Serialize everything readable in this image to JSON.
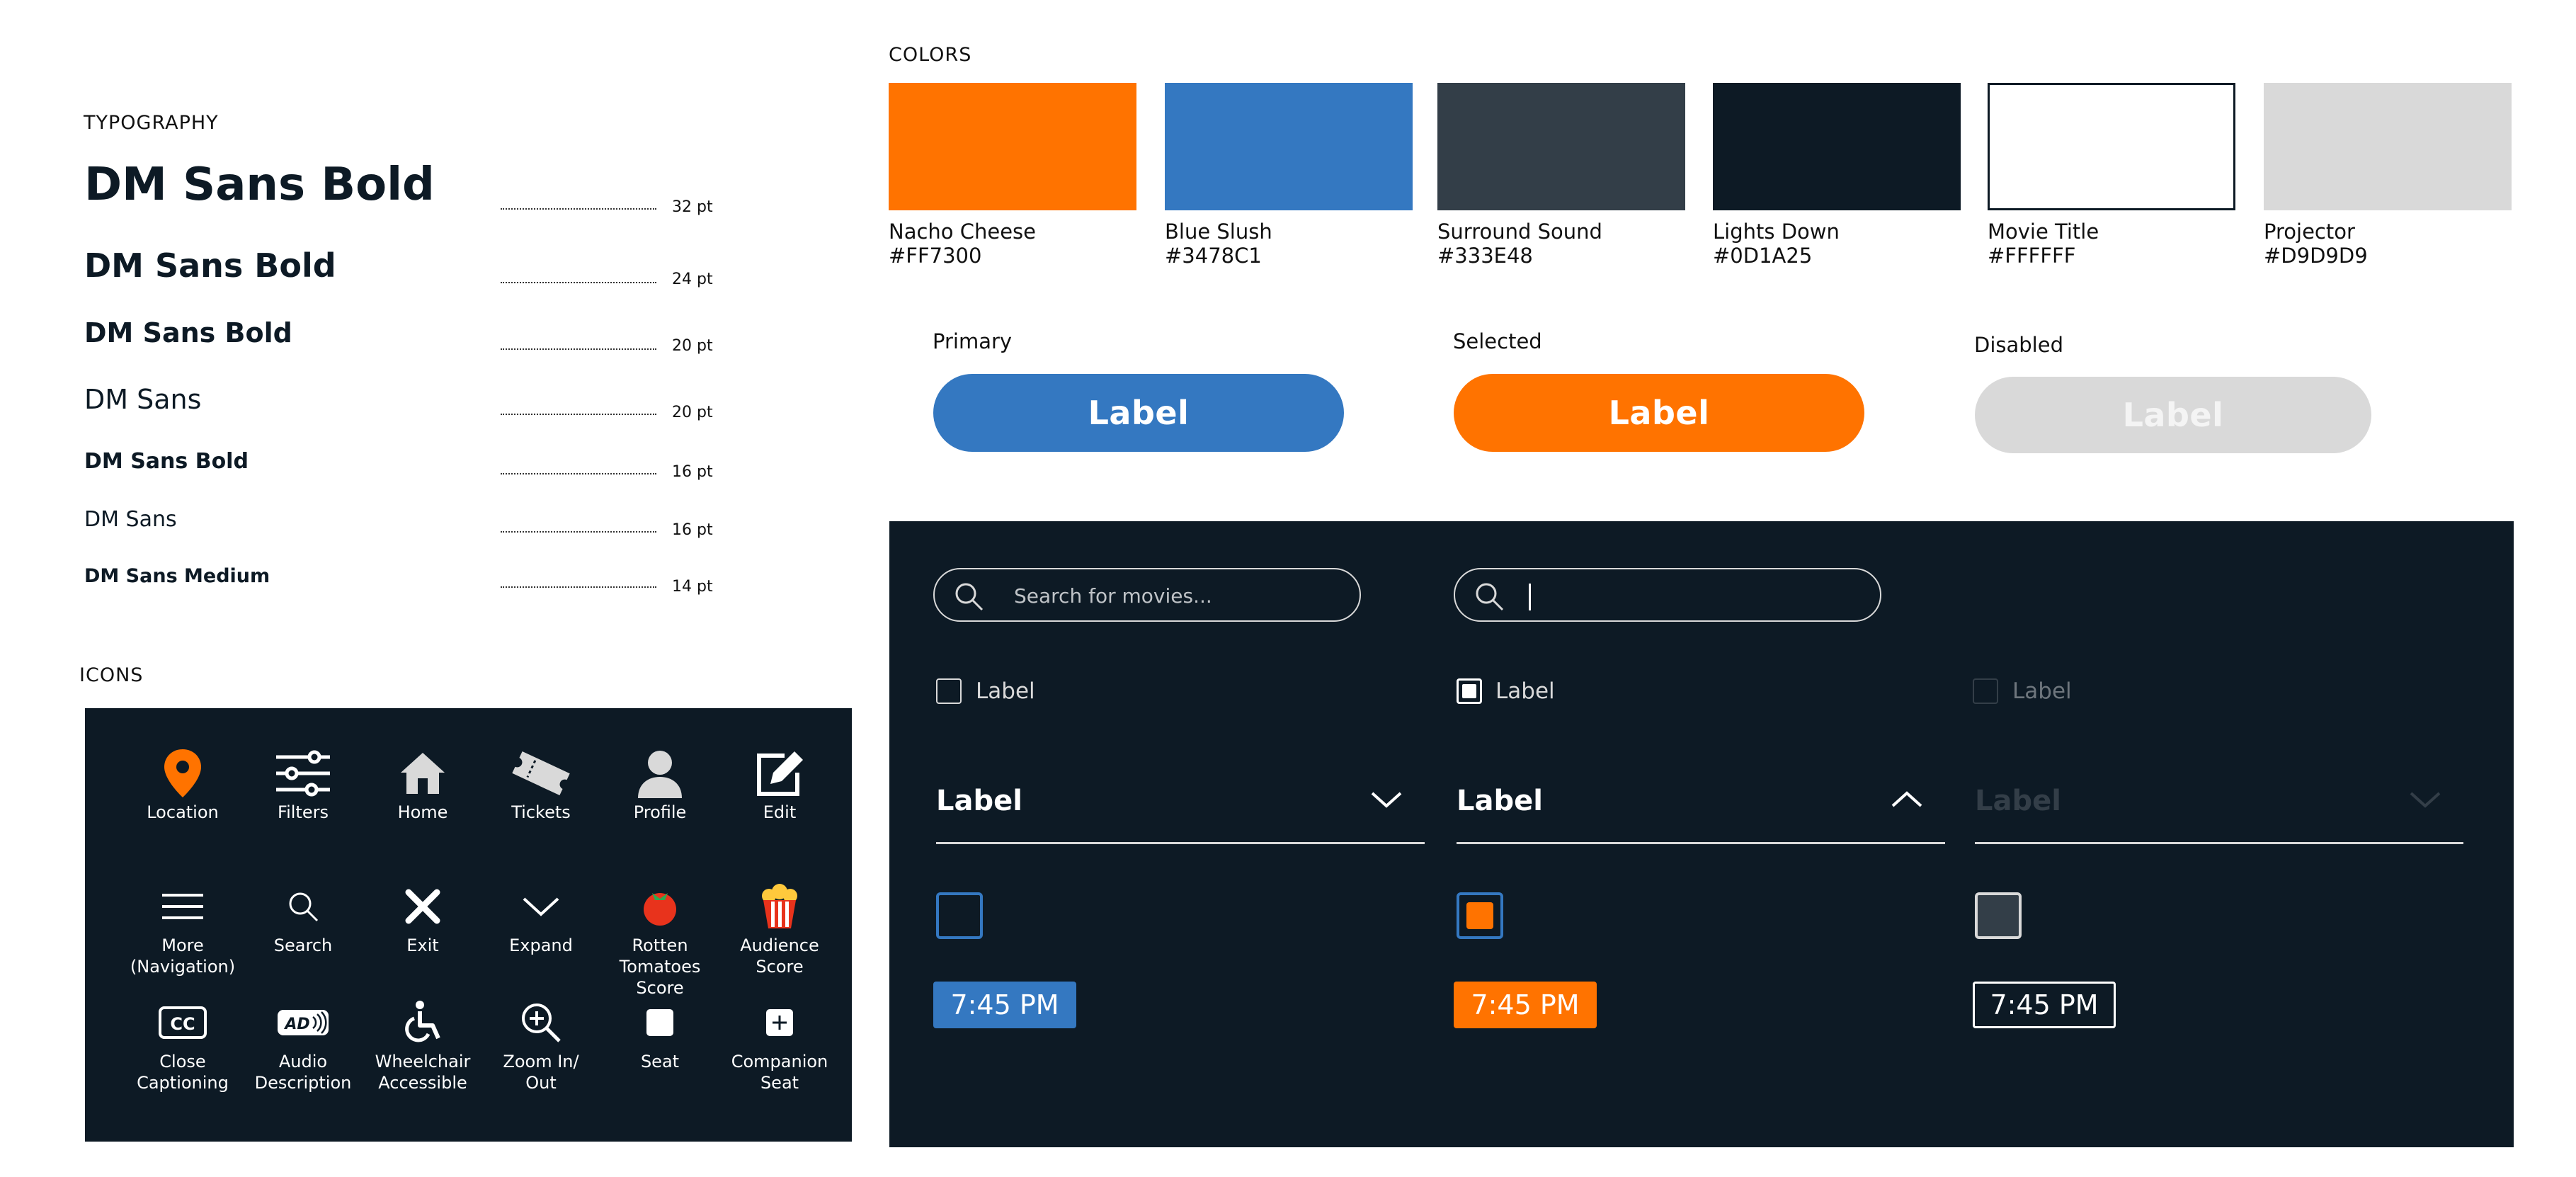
{
  "typography": {
    "title": "TYPOGRAPHY",
    "rows": [
      {
        "sample": "DM Sans Bold",
        "size": "32 pt"
      },
      {
        "sample": "DM Sans Bold",
        "size": "24 pt"
      },
      {
        "sample": "DM Sans Bold",
        "size": "20 pt"
      },
      {
        "sample": "DM Sans",
        "size": "20 pt"
      },
      {
        "sample": "DM Sans Bold",
        "size": "16 pt"
      },
      {
        "sample": "DM Sans",
        "size": "16 pt"
      },
      {
        "sample": "DM Sans Medium",
        "size": "14 pt"
      }
    ]
  },
  "colors": {
    "title": "COLORS",
    "swatches": [
      {
        "name": "Nacho Cheese",
        "hex": "#FF7300"
      },
      {
        "name": "Blue Slush",
        "hex": "#3478C1"
      },
      {
        "name": "Surround Sound",
        "hex": "#333E48"
      },
      {
        "name": "Lights Down",
        "hex": "#0D1A25"
      },
      {
        "name": "Movie Title",
        "hex": "#FFFFFF"
      },
      {
        "name": "Projector",
        "hex": "#D9D9D9"
      }
    ]
  },
  "buttons": {
    "primary": {
      "caption": "Primary",
      "label": "Label"
    },
    "selected": {
      "caption": "Selected",
      "label": "Label"
    },
    "disabled": {
      "caption": "Disabled",
      "label": "Label"
    }
  },
  "icons": {
    "title": "ICONS",
    "items": [
      {
        "label": "Location",
        "icon": "location-icon"
      },
      {
        "label": "Filters",
        "icon": "filters-icon"
      },
      {
        "label": "Home",
        "icon": "home-icon"
      },
      {
        "label": "Tickets",
        "icon": "tickets-icon"
      },
      {
        "label": "Profile",
        "icon": "profile-icon"
      },
      {
        "label": "Edit",
        "icon": "edit-icon"
      },
      {
        "label": "More\n(Navigation)",
        "icon": "menu-icon"
      },
      {
        "label": "Search",
        "icon": "search-icon"
      },
      {
        "label": "Exit",
        "icon": "close-icon"
      },
      {
        "label": "Expand",
        "icon": "chevron-down-icon"
      },
      {
        "label": "Rotten\nTomatoes Score",
        "icon": "tomato-icon"
      },
      {
        "label": "Audience\nScore",
        "icon": "popcorn-icon"
      },
      {
        "label": "Close\nCaptioning",
        "icon": "cc-icon"
      },
      {
        "label": "Audio\nDescription",
        "icon": "audio-description-icon"
      },
      {
        "label": "Wheelchair\nAccessible",
        "icon": "wheelchair-icon"
      },
      {
        "label": "Zoom In/\nOut",
        "icon": "zoom-icon"
      },
      {
        "label": "Seat",
        "icon": "seat-icon"
      },
      {
        "label": "Companion\nSeat",
        "icon": "companion-seat-icon"
      }
    ]
  },
  "components": {
    "search": {
      "placeholder": "Search for movies..."
    },
    "checkbox": {
      "label": "Label"
    },
    "dropdown": {
      "label": "Label"
    },
    "time": {
      "label": "7:45 PM"
    }
  }
}
